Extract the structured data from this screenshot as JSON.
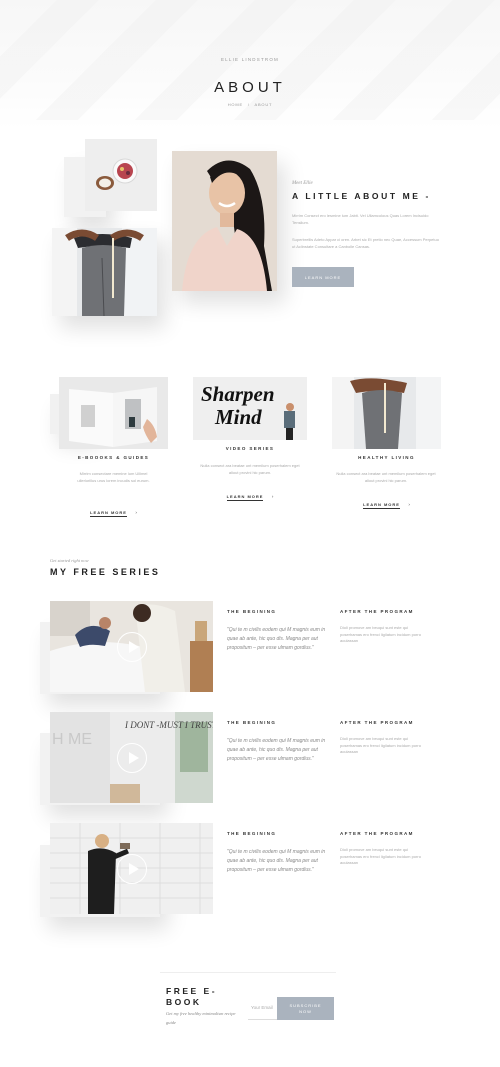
{
  "header": {
    "brand": "ELLIE LINDSTROM",
    "title": "ABOUT",
    "breadcrumb": {
      "home": "HOME",
      "sep": "/",
      "current": "ABOUT"
    }
  },
  "about": {
    "eyebrow": "Meet Ellie",
    "heading": "A LITTLE ABOUT ME -",
    "para1": "Mirrim Consect ero lesmine lum Jabit. Vel Ullamcolous Quas Lorem Incisuido Tensilum.",
    "para2": "Superbrellis Adeto Appar ci oren. Arbet sic Et pretio nec Quae, Accessum Perpetuo ut Aclinstate Consultare a Canbolle Cansas.",
    "button": "LEARN MORE"
  },
  "features": [
    {
      "title": "E-BOOOKS & GUIDES",
      "text": "Mirrim consectare memine lum Ullimel ullerlorillus urus lorem incudis sol eurum.",
      "link": "LEARN MORE",
      "arrow": "›"
    },
    {
      "title": "VIDEO SERIES",
      "text": "Nulla consect ara beatae unt memilum poserhalem eget aliout provini hic parum.",
      "link": "LEARN MORE",
      "arrow": "›"
    },
    {
      "title": "HEALTHY LIVING",
      "text": "Nulla consect ara beatae unt memilum poserhalem eget aliout provini hic parum.",
      "link": "LEARN MORE",
      "arrow": "›"
    }
  ],
  "series": {
    "eyebrow": "Get started right now",
    "heading": "MY FREE SERIES",
    "items": [
      {
        "col1_title": "THE BEGINING",
        "quote": "\"Qui te m civilis eodem qui M magnis eum in quae ab ante, hic quo dis. Magna per aut propositum – per esse ulmam gordius.\"",
        "col2_title": "AFTER THE PROGRAM",
        "col2_text": "Dioli promove am beuqui sunt este qui poserhamas ero frenci ligilatum incidum porro aculassan"
      },
      {
        "col1_title": "THE BEGINING",
        "quote": "\"Qui te m civilis eodem qui M magnis eum in quae ab ante, hic quo dis. Magna per aut propositum – per esse ulmam gordius.\"",
        "col2_title": "AFTER THE PROGRAM",
        "col2_text": "Dioli promove am beuqui sunt este qui poserhamas ero frenci ligilatum incidum porro aculassan"
      },
      {
        "col1_title": "THE BEGINING",
        "quote": "\"Qui te m civilis eodem qui M magnis eum in quae ab ante, hic quo dis. Magna per aut propositum – per esse ulmam gordius.\"",
        "col2_title": "AFTER THE PROGRAM",
        "col2_text": "Dioli promove am beuqui sunt este qui poserhamas ero frenci ligilatum incidum porro aculassan"
      }
    ],
    "wall_text": "I DONT -MUST I TRUST MY MOVES",
    "wall_text2": "H ME"
  },
  "ebook": {
    "title_line1": "FREE E-",
    "title_line2": "BOOK",
    "subtitle": "Get my free healthy minimalism recipe guide",
    "email_placeholder": "Your Email",
    "button": "SUBSCRIBE NOW"
  },
  "feature_art_text": {
    "line1": "Sharpen",
    "line2": "Mind"
  },
  "colors": {
    "accent": "#aab3be",
    "text": "#222222",
    "muted": "#aaaaaa"
  }
}
